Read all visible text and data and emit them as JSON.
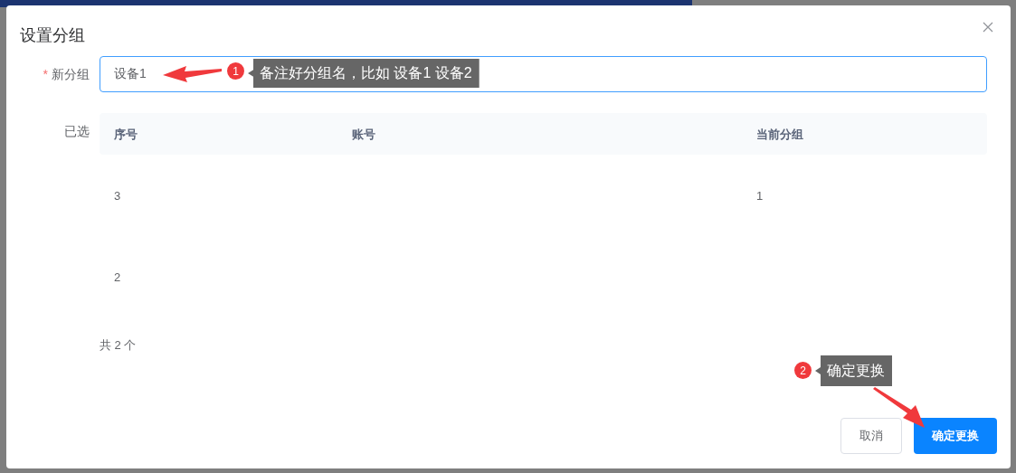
{
  "dialog": {
    "title": "设置分组",
    "new_group": {
      "label": "新分组",
      "required_mark": "*",
      "value": "设备1"
    },
    "selected_label": "已选",
    "table": {
      "columns": [
        "序号",
        "账号",
        "当前分组"
      ],
      "rows": [
        {
          "index": "3",
          "current_group": "1"
        },
        {
          "index": "2"
        }
      ]
    },
    "total": "共 2 个",
    "buttons": [
      {
        "label": "取消",
        "kind": "default"
      },
      {
        "label": "确定更换",
        "kind": "primary"
      }
    ]
  },
  "annotations": [
    {
      "number": "1",
      "text": "备注好分组名，比如 设备1 设备2"
    },
    {
      "number": "2",
      "text": "确定更换"
    }
  ]
}
